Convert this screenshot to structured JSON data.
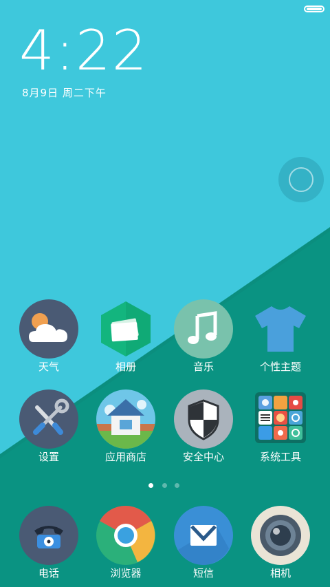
{
  "status_bar": {
    "battery_level": 1.0
  },
  "lock": {
    "time": "4:22",
    "date": "8月9日 周二下午"
  },
  "colors": {
    "sky": "#3ec8dc",
    "teal": "#0a9382"
  },
  "apps_row1": [
    {
      "label": "天气",
      "icon": "weather-icon"
    },
    {
      "label": "相册",
      "icon": "gallery-icon"
    },
    {
      "label": "音乐",
      "icon": "music-icon"
    },
    {
      "label": "个性主题",
      "icon": "theme-shirt-icon"
    }
  ],
  "apps_row2": [
    {
      "label": "设置",
      "icon": "settings-tools-icon"
    },
    {
      "label": "应用商店",
      "icon": "app-store-house-icon"
    },
    {
      "label": "安全中心",
      "icon": "security-shield-icon"
    },
    {
      "label": "系统工具",
      "icon": "system-tools-folder-icon"
    }
  ],
  "page_indicator": {
    "pages": 3,
    "current": 1
  },
  "dock": [
    {
      "label": "电话",
      "icon": "phone-icon"
    },
    {
      "label": "浏览器",
      "icon": "browser-icon"
    },
    {
      "label": "短信",
      "icon": "sms-mail-icon"
    },
    {
      "label": "相机",
      "icon": "camera-lens-icon"
    }
  ]
}
